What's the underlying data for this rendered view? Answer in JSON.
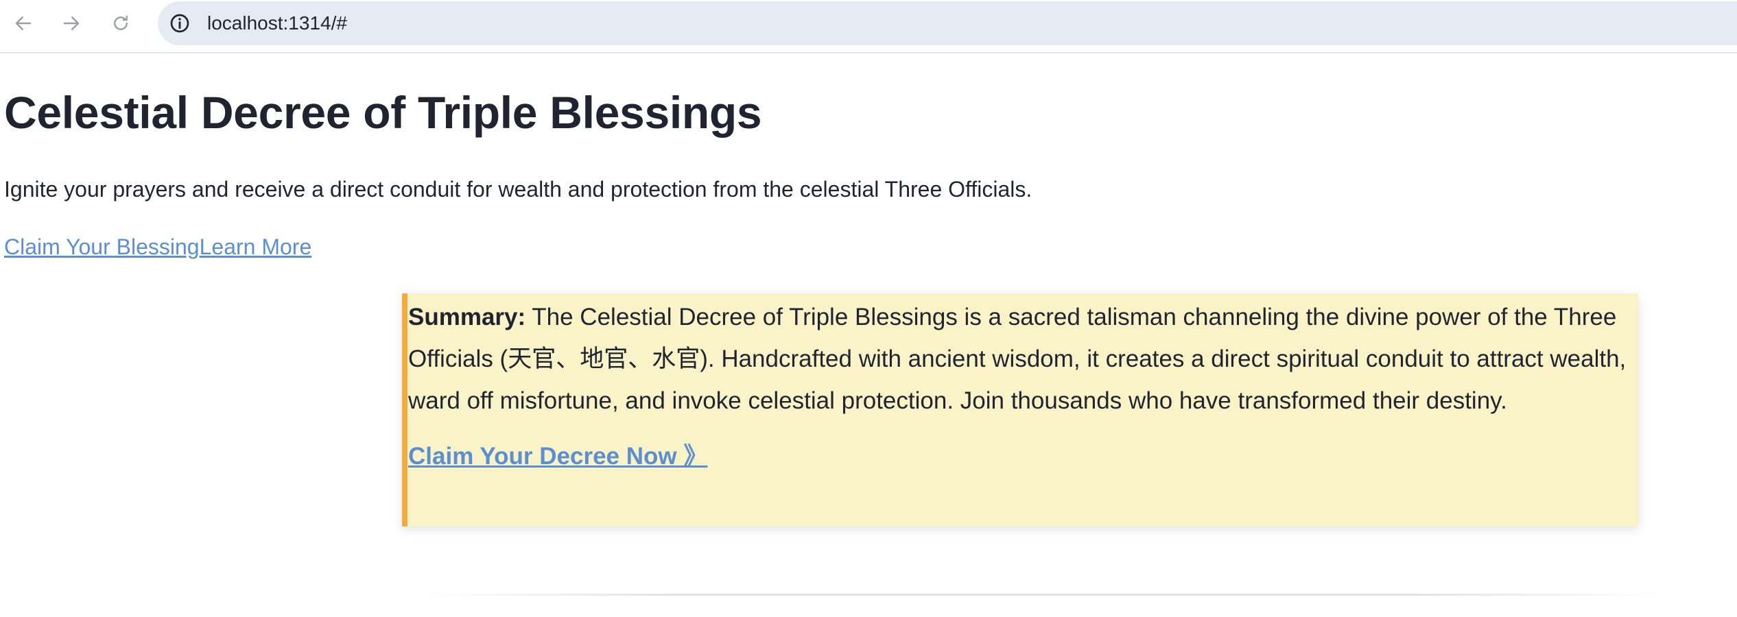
{
  "browser": {
    "url": "localhost:1314/#"
  },
  "hero": {
    "title": "Celestial Decree of Triple Blessings",
    "subtitle": "Ignite your prayers and receive a direct conduit for wealth and protection from the celestial Three Officials.",
    "cta_primary": "Claim Your Blessing",
    "cta_secondary": "Learn More"
  },
  "summary": {
    "label": "Summary:",
    "text": " The Celestial Decree of Triple Blessings is a sacred talisman channeling the divine power of the Three Officials (天官、地官、水官). Handcrafted with ancient wisdom, it creates a direct spiritual conduit to attract wealth, ward off misfortune, and invoke celestial protection. Join thousands who have transformed their destiny.",
    "cta": "Claim Your Decree Now 》"
  },
  "colors": {
    "link": "#5b8fd1",
    "summary_bg": "#fbf3c8",
    "summary_border": "#f0ad3e",
    "text": "#1f2430"
  }
}
